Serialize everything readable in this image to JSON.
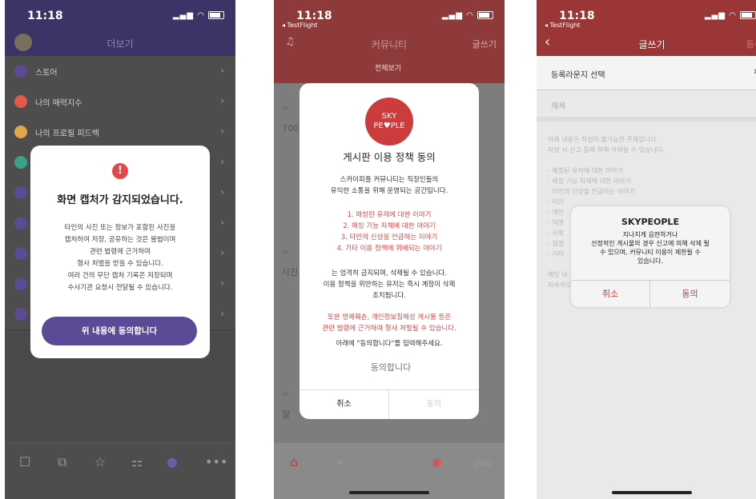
{
  "screen1": {
    "time": "11:18",
    "header_title": "더보기",
    "menu": [
      {
        "label": "스토어",
        "icon": "heart-icon",
        "color": "#5b4a96"
      },
      {
        "label": "나의 매력지수",
        "icon": "star-icon",
        "color": "#e05a4a"
      },
      {
        "label": "나의 프로필 피드백",
        "icon": "feedback-icon",
        "color": "#e0a84a"
      },
      {
        "label": "",
        "icon": "clock-icon",
        "color": "#3aa08a"
      },
      {
        "label": "",
        "icon": "chat-icon",
        "color": "#5b4a96"
      },
      {
        "label": "",
        "icon": "phone-icon",
        "color": "#5b4a96"
      },
      {
        "label": "",
        "icon": "friends-icon",
        "color": "#5b4a96"
      },
      {
        "label": "",
        "icon": "mail-icon",
        "color": "#5b4a96"
      },
      {
        "label": "",
        "icon": "settings-icon",
        "color": "#5b4a96"
      }
    ],
    "dialog": {
      "title": "화면 캡처가 감지되었습니다.",
      "lines": [
        "타인의 사진 또는 정보가 포함된 사진을",
        "캡처하여 저장, 공유하는 것은 불법이며",
        "관련 법령에 근거하여",
        "형사 처벌을 받을 수 있습니다.",
        "여러 건의 무단 캡처 기록은 저장되며",
        "수사기관 요청시 전달될 수 있습니다."
      ],
      "button": "위 내용에 동의합니다"
    }
  },
  "screen2": {
    "time": "11:18",
    "back_app": "◂ TestFlight",
    "header_title": "커뮤니티",
    "write": "글쓰기",
    "tab_active": "전체보기",
    "dialog": {
      "logo_line1": "SKY",
      "logo_line2": "PE♥PLE",
      "title": "게시판 이용 정책 동의",
      "intro1": "스카이피플 커뮤니티는 직장인들의",
      "intro2": "유익한 소통을 위해 운영되는 공간입니다.",
      "rules": [
        "1. 매칭된 유저에 대한 이야기",
        "2. 매칭 기능 자체에 대한 이야기",
        "3. 타인의 신상을 언급하는 이야기",
        "4. 기타 이용 정책에 위배되는 이야기"
      ],
      "rule1": "는 엄격히 금지되며, 삭제될 수 있습니다.",
      "rule2": "이용 정책을 위반하는 유저는 즉시 계정이 삭제",
      "rule3": "조치됩니다.",
      "warn1": "또한 명예훼손, 개인정보침해성 게시물 등은",
      "warn2": "관련 법령에 근거하여 형사 처벌될 수 있습니다.",
      "ask": "아래에 \"동의합니다\"를 입력해주세요.",
      "input_placeholder": "동의합니다",
      "cancel": "취소",
      "agree": "동의"
    }
  },
  "screen3": {
    "time": "11:18",
    "back_app": "◂ TestFlight",
    "header_title": "글쓰기",
    "register": "등록",
    "lounge": "등록라운지 선택",
    "subject_placeholder": "제목",
    "guide": [
      "아래 내용은 작성이 불가능한 주제입니다.",
      "작성 시 신고 등에 의해 삭제될 수 있습니다.",
      "",
      "- 매칭된 유저에 대한 이야기",
      "- 매칭 기능 자체에 대한 이야기",
      "- 타인의 신상을 언급하는 이야기",
      "- 타인",
      "- 개인",
      "- 익명",
      "- 사회",
      "- 일정",
      "- 기타",
      "",
      "해당 내",
      "지속적으로 위반시 커뮤니티 이용이 제한될 수 있습니다."
    ],
    "dialog": {
      "title": "SKYPEOPLE",
      "msg1": "지나치게 음란하거나",
      "msg2": "선정적인 게시물의 경우 신고에 의해 삭제 될",
      "msg3": "수 있으며, 커뮤니티 이용이 제한될 수",
      "msg4": "있습니다.",
      "cancel": "취소",
      "agree": "동의"
    }
  }
}
